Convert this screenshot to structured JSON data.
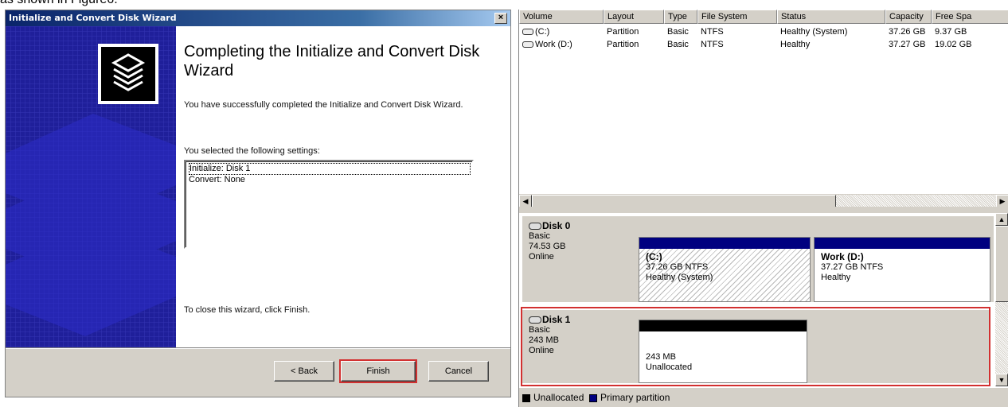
{
  "caption": "as shown in Figure6.",
  "wizard": {
    "title": "Initialize and Convert Disk Wizard",
    "close_glyph": "×",
    "heading": "Completing the Initialize and Convert Disk Wizard",
    "success_text": "You have successfully completed the Initialize and Convert Disk Wizard.",
    "settings_label": "You selected the following settings:",
    "settings": [
      "Initialize: Disk 1",
      "Convert: None"
    ],
    "close_instruction": "To close this wizard, click Finish.",
    "buttons": {
      "back": "< Back",
      "finish": "Finish",
      "cancel": "Cancel"
    },
    "colors": {
      "side_panel": "#1f1f9a",
      "highlight": "#d23030"
    }
  },
  "volumes": {
    "columns": [
      "Volume",
      "Layout",
      "Type",
      "File System",
      "Status",
      "Capacity",
      "Free Spa"
    ],
    "rows": [
      [
        "(C:)",
        "Partition",
        "Basic",
        "NTFS",
        "Healthy (System)",
        "37.26 GB",
        "9.37 GB"
      ],
      [
        "Work (D:)",
        "Partition",
        "Basic",
        "NTFS",
        "Healthy",
        "37.27 GB",
        "19.02 GB"
      ]
    ]
  },
  "disks": [
    {
      "name": "Disk 0",
      "type": "Basic",
      "size": "74.53 GB",
      "state": "Online",
      "partitions": [
        {
          "name": "(C:)",
          "detail": "37.26 GB NTFS",
          "status": "Healthy (System)"
        },
        {
          "name": "Work  (D:)",
          "detail": "37.27 GB NTFS",
          "status": "Healthy"
        }
      ]
    },
    {
      "name": "Disk 1",
      "type": "Basic",
      "size": "243 MB",
      "state": "Online",
      "partitions": [
        {
          "name": "",
          "detail": "243 MB",
          "status": "Unallocated"
        }
      ]
    }
  ],
  "legend": [
    {
      "label": "Unallocated",
      "color": "#000000"
    },
    {
      "label": "Primary partition",
      "color": "#000080"
    }
  ]
}
